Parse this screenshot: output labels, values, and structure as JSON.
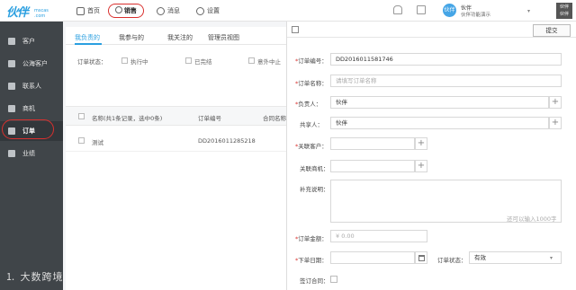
{
  "header": {
    "logo": "伙伴",
    "logo_sub": "mscas\n.com",
    "nav": [
      {
        "label": "首页",
        "icon": "home-icon"
      },
      {
        "label": "销售",
        "icon": "sales-icon"
      },
      {
        "label": "消息",
        "icon": "message-icon"
      },
      {
        "label": "设置",
        "icon": "settings-icon"
      }
    ],
    "avatar_text": "伙伴",
    "user_name": "伙伴",
    "user_role": "伙伴功能演示",
    "corner_logo": "伙伴\n伙伴"
  },
  "sidebar": {
    "items": [
      {
        "label": "客户",
        "icon": "customer-icon"
      },
      {
        "label": "公海客户",
        "icon": "public-customer-icon"
      },
      {
        "label": "联系人",
        "icon": "contact-icon"
      },
      {
        "label": "商机",
        "icon": "opportunity-icon"
      },
      {
        "label": "订单",
        "icon": "order-icon",
        "active": true
      },
      {
        "label": "业绩",
        "icon": "performance-icon"
      }
    ],
    "watermark": "大数跨境"
  },
  "list": {
    "tabs": [
      "我负责的",
      "我参与的",
      "我关注的",
      "管理员视图"
    ],
    "filter_label": "订单状态：",
    "filters": [
      "执行中",
      "已完结",
      "意外中止"
    ],
    "columns": [
      "名称(共1条记录，选中0条)",
      "订单编号",
      "合同名称"
    ],
    "rows": [
      {
        "name": "测试",
        "order_no": "DD2016011285218"
      }
    ]
  },
  "detail": {
    "save_label": "提交",
    "fields": {
      "order_no": {
        "label": "订单编号：",
        "value": "DD2016011581746"
      },
      "order_name": {
        "label": "订单名称：",
        "placeholder": "请填写订单名称"
      },
      "owner": {
        "label": "负责人：",
        "value": "伙伴"
      },
      "participants": {
        "label": "共享人：",
        "value": "伙伴"
      },
      "customer": {
        "label": "关联客户："
      },
      "opportunity": {
        "label": "关联商机："
      },
      "note": {
        "label": "补充说明：",
        "hint": "还可以输入1000字"
      },
      "amount": {
        "label": "订单金额：",
        "placeholder": "¥ 0.00"
      },
      "order_date": {
        "label": "下单日期："
      },
      "status": {
        "label": "订单状态：",
        "value": "有效"
      },
      "signed": {
        "label": "签订合同："
      }
    }
  }
}
